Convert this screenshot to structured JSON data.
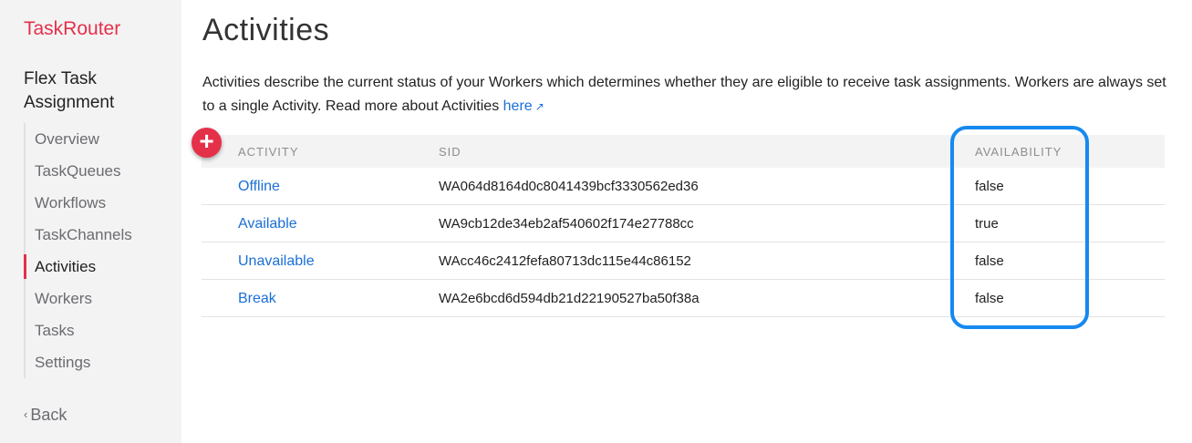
{
  "sidebar": {
    "brand": "TaskRouter",
    "section_title": "Flex Task Assignment",
    "items": [
      {
        "label": "Overview"
      },
      {
        "label": "TaskQueues"
      },
      {
        "label": "Workflows"
      },
      {
        "label": "TaskChannels"
      },
      {
        "label": "Activities",
        "active": true
      },
      {
        "label": "Workers"
      },
      {
        "label": "Tasks"
      },
      {
        "label": "Settings"
      }
    ],
    "back_label": "Back"
  },
  "main": {
    "title": "Activities",
    "description": "Activities describe the current status of your Workers which determines whether they are eligible to receive task assignments. Workers are always set to a single Activity. Read more about Activities",
    "here_link": "here",
    "add_button": "+"
  },
  "table": {
    "columns": [
      "ACTIVITY",
      "SID",
      "AVAILABILITY"
    ],
    "rows": [
      {
        "activity": "Offline",
        "sid": "WA064d8164d0c8041439bcf3330562ed36",
        "availability": "false"
      },
      {
        "activity": "Available",
        "sid": "WA9cb12de34eb2af540602f174e27788cc",
        "availability": "true"
      },
      {
        "activity": "Unavailable",
        "sid": "WAcc46c2412fefa80713dc115e44c86152",
        "availability": "false"
      },
      {
        "activity": "Break",
        "sid": "WA2e6bcd6d594db21d22190527ba50f38a",
        "availability": "false"
      }
    ]
  },
  "colors": {
    "brand": "#e5304a",
    "link": "#1a6fd6",
    "highlight": "#1689f0"
  }
}
